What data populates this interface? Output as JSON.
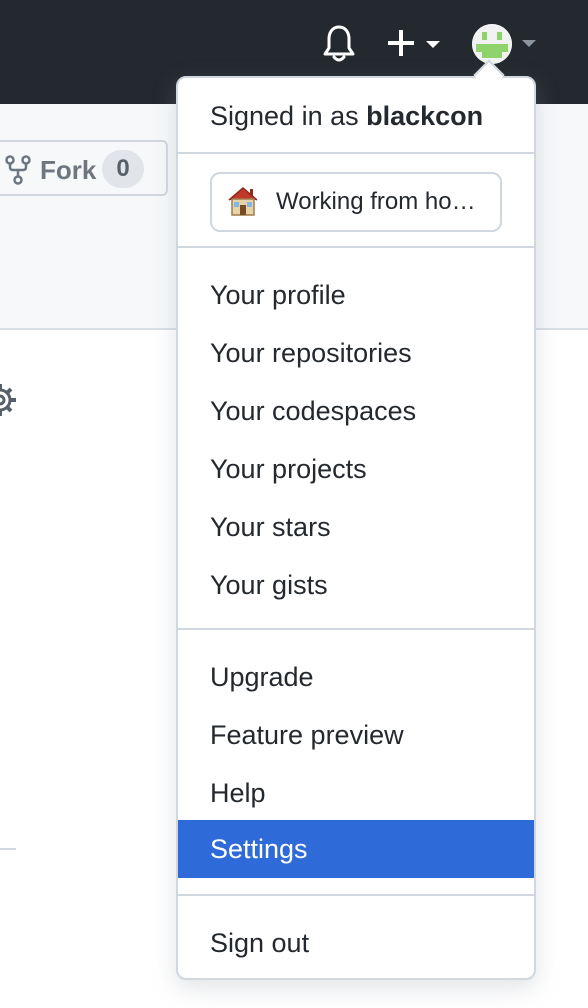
{
  "header": {
    "icons": [
      "bell-icon",
      "plus-icon",
      "avatar"
    ]
  },
  "repo": {
    "fork_label": "Fork",
    "fork_count": "0"
  },
  "menu": {
    "signed_in_prefix": "Signed in as",
    "username": "blackcon",
    "status": {
      "emoji": "house-icon",
      "text": "Working from ho…"
    },
    "profile_items": [
      "Your profile",
      "Your repositories",
      "Your codespaces",
      "Your projects",
      "Your stars",
      "Your gists"
    ],
    "misc_items": [
      "Upgrade",
      "Feature preview",
      "Help",
      "Settings"
    ],
    "active_item": "Settings",
    "sign_out": "Sign out"
  },
  "colors": {
    "topbar": "#24292f",
    "highlight": "#2f6bd8",
    "avatar_green": "#8ed36b"
  }
}
